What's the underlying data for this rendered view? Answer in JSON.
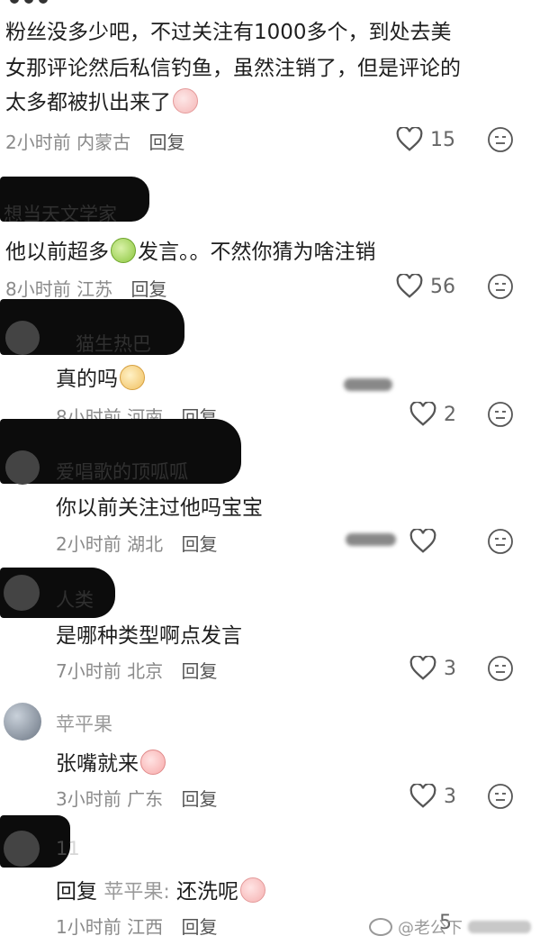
{
  "comments": [
    {
      "id": "c1",
      "text_lines": [
        "粉丝没多少吧，不过关注有1000多个，到处去美",
        "女那评论然后私信钓鱼，虽然注销了，但是评论的",
        "太多都被扒出来了"
      ],
      "time": "2小时前",
      "location": "内蒙古",
      "reply_label": "回复",
      "likes": "15"
    },
    {
      "id": "c2",
      "username": "想当天文学家",
      "text_a": "他以前超多",
      "text_b": "发言。。不然你猜为啥注销",
      "time": "8小时前",
      "location": "江苏",
      "reply_label": "回复",
      "likes": "56"
    },
    {
      "id": "r1",
      "username": "猫生热巴",
      "text": "真的吗",
      "time": "8小时前",
      "location": "河南",
      "reply_label": "回复",
      "likes": "2"
    },
    {
      "id": "r2",
      "username": "爱唱歌的顶呱呱",
      "text": "你以前关注过他吗宝宝",
      "time": "2小时前",
      "location": "湖北",
      "reply_label": "回复",
      "likes": ""
    },
    {
      "id": "r3",
      "username": "人类",
      "text": "是哪种类型啊点发言",
      "time": "7小时前",
      "location": "北京",
      "reply_label": "回复",
      "likes": "3"
    },
    {
      "id": "r4",
      "username": "苹平果",
      "text": "张嘴就来",
      "time": "3小时前",
      "location": "广东",
      "reply_label": "回复",
      "likes": "3"
    },
    {
      "id": "r5",
      "username": "11",
      "reply_prefix": "回复",
      "reply_to": "苹平果:",
      "text": "还洗呢",
      "time": "1小时前",
      "location": "江西",
      "reply_label": "回复",
      "likes": "5"
    }
  ],
  "icons": {
    "like": "heart-outline-icon",
    "dislike": "meh-face-icon"
  },
  "watermark": "@老公下",
  "colors": {
    "meta": "#8a8a8a",
    "text": "#1e1e1e",
    "bg": "#ffffff"
  }
}
